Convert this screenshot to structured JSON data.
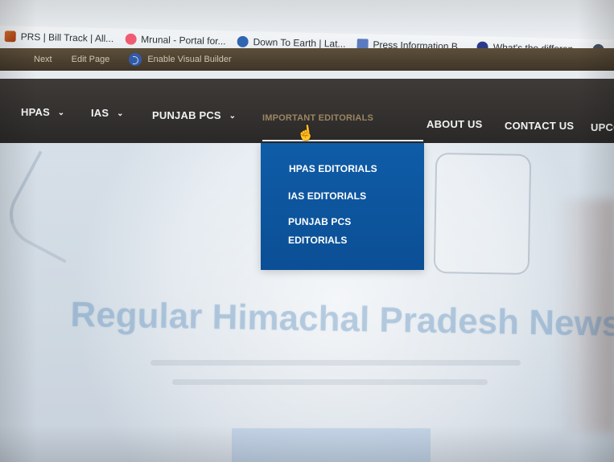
{
  "bookmarks": [
    {
      "label": "PRS | Bill Track | All...",
      "icon": "prs-icon"
    },
    {
      "label": "Mrunal - Portal for...",
      "icon": "mrunal-icon"
    },
    {
      "label": "Down To Earth | Lat...",
      "icon": "down-to-earth-icon"
    },
    {
      "label": "Press Information B...",
      "icon": "pib-icon"
    },
    {
      "label": "What's the differen...",
      "icon": "whats-difference-icon"
    }
  ],
  "admin_bar": {
    "next": "Next",
    "edit_page": "Edit Page",
    "enable_visual_builder": "Enable Visual Builder"
  },
  "nav": {
    "hpas": "HPAS",
    "ias": "IAS",
    "punjab_pcs": "PUNJAB PCS",
    "important_editorials": "IMPORTANT EDITORIALS",
    "about_us": "ABOUT US",
    "contact_us": "CONTACT US",
    "upcoming": "UPCO"
  },
  "dropdown": {
    "items": [
      "HPAS EDITORIALS",
      "IAS EDITORIALS",
      "PUNJAB PCS",
      "EDITORIALS"
    ]
  },
  "hero": {
    "title": "Regular Himachal Pradesh News"
  },
  "colors": {
    "nav_background": "#2b2928",
    "dropdown_background": "#0b4f95",
    "hero_title": "#447eb6"
  }
}
